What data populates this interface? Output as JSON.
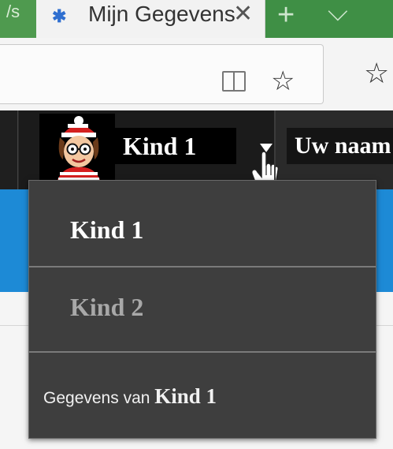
{
  "browser": {
    "left_tab_fragment": "/s",
    "active_tab": {
      "title": "Mijn Gegevens",
      "close_glyph": "✕",
      "favicon": "site-favicon-icon"
    },
    "new_tab_glyph": "+",
    "tab_menu_glyph": "⌵",
    "toolbar_icons": [
      "reading-view-icon",
      "favorite-star-icon",
      "favorites-list-icon"
    ]
  },
  "header": {
    "profile": {
      "name": "Kind 1",
      "avatar": "wally-avatar"
    },
    "name_field_value": "Uw naam"
  },
  "dropdown": {
    "items": [
      {
        "label": "Kind 1",
        "state": "selected"
      },
      {
        "label": "Kind 2",
        "state": "inactive"
      }
    ],
    "details_link": {
      "prefix": "Gegevens van ",
      "name": "Kind 1"
    }
  },
  "colors": {
    "tab_strip": "#3f8f45",
    "header_bg": "#2a2a2a",
    "menu_bg": "#3e3e3e",
    "page_accent": "#1d8ad6"
  }
}
